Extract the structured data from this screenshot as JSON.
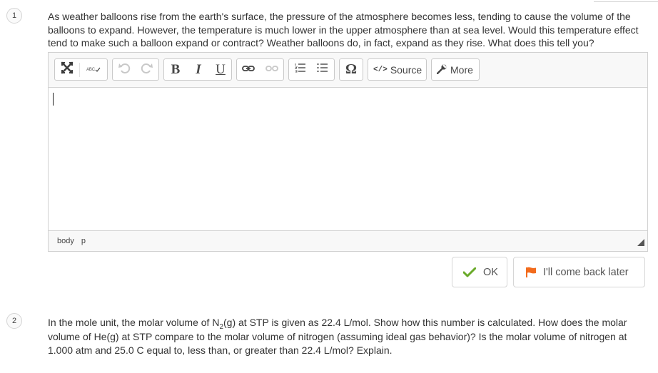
{
  "question1": {
    "number": "1",
    "text": "As weather balloons rise from the earth's surface, the pressure of the atmosphere becomes less, tending to cause the volume of the balloons to expand. However, the temperature is much lower in the upper atmosphere than at sea level. Would this temperature effect tend to make such a balloon expand or contract? Weather balloons do, in fact, expand as they rise. What does this tell you?"
  },
  "editor": {
    "toolbar": {
      "source_label": "Source",
      "more_label": "More",
      "spellcheck_label": "ABC",
      "bold_label": "B",
      "italic_label": "I",
      "underline_label": "U",
      "special_char_label": "Ω"
    },
    "content_value": "",
    "path": [
      "body",
      "p"
    ]
  },
  "actions": {
    "ok_label": "OK",
    "later_label": "I'll come back later"
  },
  "colors": {
    "ok_check": "#6aaa2a",
    "flag": "#f26b1d"
  },
  "question2": {
    "number": "2",
    "text_before_sub": "In the mole unit, the molar volume of N",
    "subscript": "2",
    "text_after_sub": "(g) at STP is given as 22.4 L/mol. Show how this number is calculated. How does the molar volume of He(g) at STP compare to the molar volume of nitrogen (assuming ideal gas behavior)? Is the molar volume of nitrogen at 1.000 atm and 25.0 C equal to, less than, or greater than 22.4 L/mol? Explain."
  }
}
